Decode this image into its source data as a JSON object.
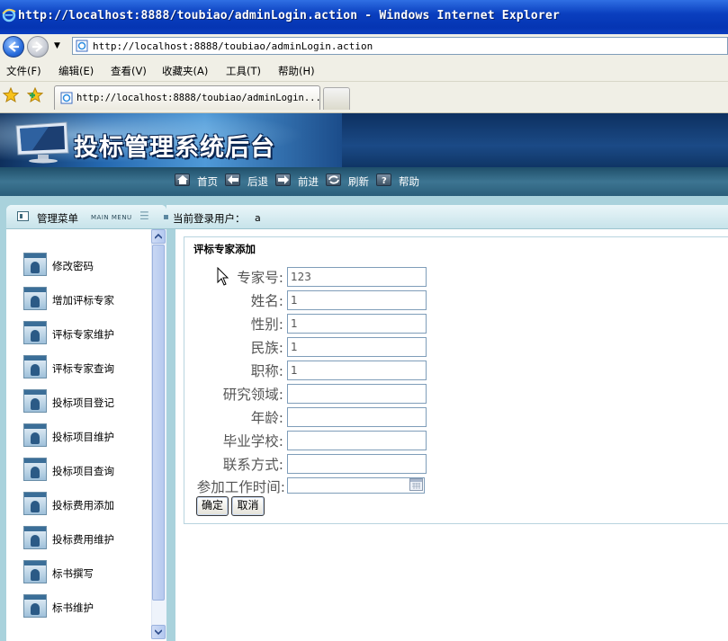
{
  "window": {
    "title": "http://localhost:8888/toubiao/adminLogin.action - Windows Internet Explorer"
  },
  "address_bar": {
    "url": "http://localhost:8888/toubiao/adminLogin.action"
  },
  "menu_bar": {
    "items": [
      "文件(F)",
      "编辑(E)",
      "查看(V)",
      "收藏夹(A)",
      "工具(T)",
      "帮助(H)"
    ]
  },
  "tabs": {
    "active_title": "http://localhost:8888/toubiao/adminLogin...."
  },
  "banner": {
    "title": "投标管理系统后台"
  },
  "nav": {
    "items": [
      "首页",
      "后退",
      "前进",
      "刷新",
      "帮助"
    ]
  },
  "sidebar": {
    "title": "管理菜单",
    "subtitle": "MAIN MENU",
    "items": [
      "修改密码",
      "增加评标专家",
      "评标专家维护",
      "评标专家查询",
      "投标项目登记",
      "投标项目维护",
      "投标项目查询",
      "投标费用添加",
      "投标费用维护",
      "标书撰写",
      "标书维护"
    ]
  },
  "user_bar": {
    "label": "当前登录用户：",
    "username": "a"
  },
  "form": {
    "title": "评标专家添加",
    "fields": [
      {
        "label": "专家号:",
        "value": "123"
      },
      {
        "label": "姓名:",
        "value": "1"
      },
      {
        "label": "性别:",
        "value": "1"
      },
      {
        "label": "民族:",
        "value": "1"
      },
      {
        "label": "职称:",
        "value": "1"
      },
      {
        "label": "研究领域:",
        "value": ""
      },
      {
        "label": "年龄:",
        "value": ""
      },
      {
        "label": "毕业学校:",
        "value": ""
      },
      {
        "label": "联系方式:",
        "value": ""
      },
      {
        "label": "参加工作时间:",
        "value": ""
      }
    ],
    "confirm_label": "确定",
    "cancel_label": "取消"
  },
  "colors": {
    "titlebar_blue": "#0a3fbf",
    "banner_navy": "#1b4a86",
    "panel_teal": "#a9d2dc"
  }
}
